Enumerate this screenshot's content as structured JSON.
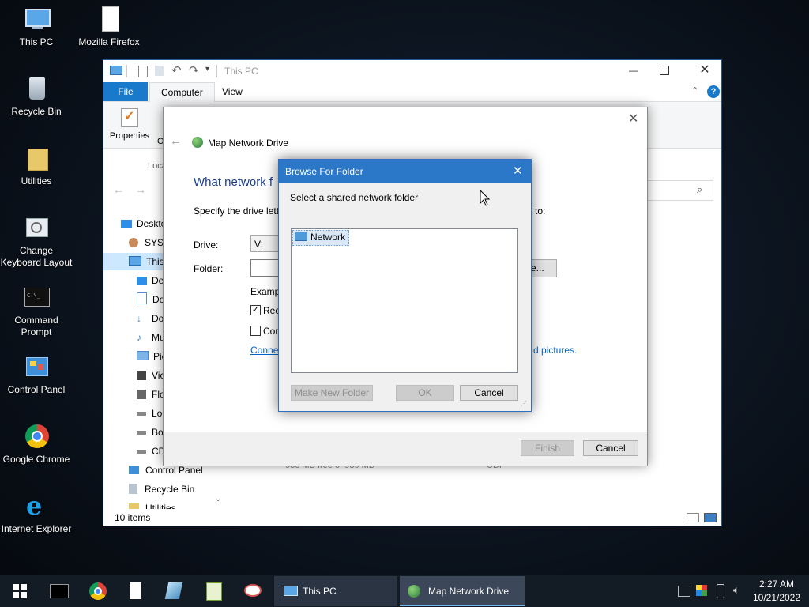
{
  "desktop": {
    "icons": [
      {
        "label": "This PC"
      },
      {
        "label": "Mozilla Firefox"
      },
      {
        "label": "Recycle Bin"
      },
      {
        "label": "Utilities"
      },
      {
        "label": "Change Keyboard Layout"
      },
      {
        "label": "Command Prompt"
      },
      {
        "label": "Control Panel"
      },
      {
        "label": "Google Chrome"
      },
      {
        "label": "Internet Explorer"
      }
    ]
  },
  "explorer": {
    "title": "This PC",
    "tabs": [
      "File",
      "Computer",
      "View"
    ],
    "ribbon": {
      "properties_label": "Properties",
      "properties_partial": "O",
      "group_partial": "Loca"
    },
    "nav": [
      {
        "label": "Deskto"
      },
      {
        "label": "SYST"
      },
      {
        "label": "This"
      },
      {
        "label": "De"
      },
      {
        "label": "Do"
      },
      {
        "label": "Do"
      },
      {
        "label": "Mu"
      },
      {
        "label": "Pic"
      },
      {
        "label": "Vic"
      },
      {
        "label": "Flo"
      },
      {
        "label": "Lo"
      },
      {
        "label": "Bo"
      },
      {
        "label": "CD"
      },
      {
        "label": "Control Panel"
      },
      {
        "label": "Recycle Bin"
      },
      {
        "label": "Utilities"
      }
    ],
    "status": "10 items",
    "background_text": {
      "free1": "986 MB free of 989 MB",
      "fs": "UDF"
    }
  },
  "wizard": {
    "title": "Map Network Drive",
    "heading_partial": "What network f",
    "instruction_partial": "Specify the drive lett",
    "instruction_tail": "to:",
    "drive_label": "Drive:",
    "drive_value": "V:",
    "folder_label": "Folder:",
    "browse_label_partial": "e...",
    "example_partial": "Examp",
    "reconnect_partial": "Rec",
    "connect_partial": "Con",
    "link_partial_left": "Conne",
    "link_partial_right": "d pictures.",
    "finish_label": "Finish",
    "cancel_label": "Cancel"
  },
  "browse": {
    "title": "Browse For Folder",
    "prompt": "Select a shared network folder",
    "tree_item": "Network",
    "new_folder_label": "Make New Folder",
    "ok_label": "OK",
    "cancel_label": "Cancel"
  },
  "taskbar": {
    "windows": [
      {
        "label": "This PC"
      },
      {
        "label": "Map Network Drive"
      }
    ],
    "time": "2:27 AM",
    "date": "10/21/2022"
  },
  "colors": {
    "accent": "#2b78c8",
    "file_tab": "#1979ca",
    "link": "#0066cc"
  }
}
